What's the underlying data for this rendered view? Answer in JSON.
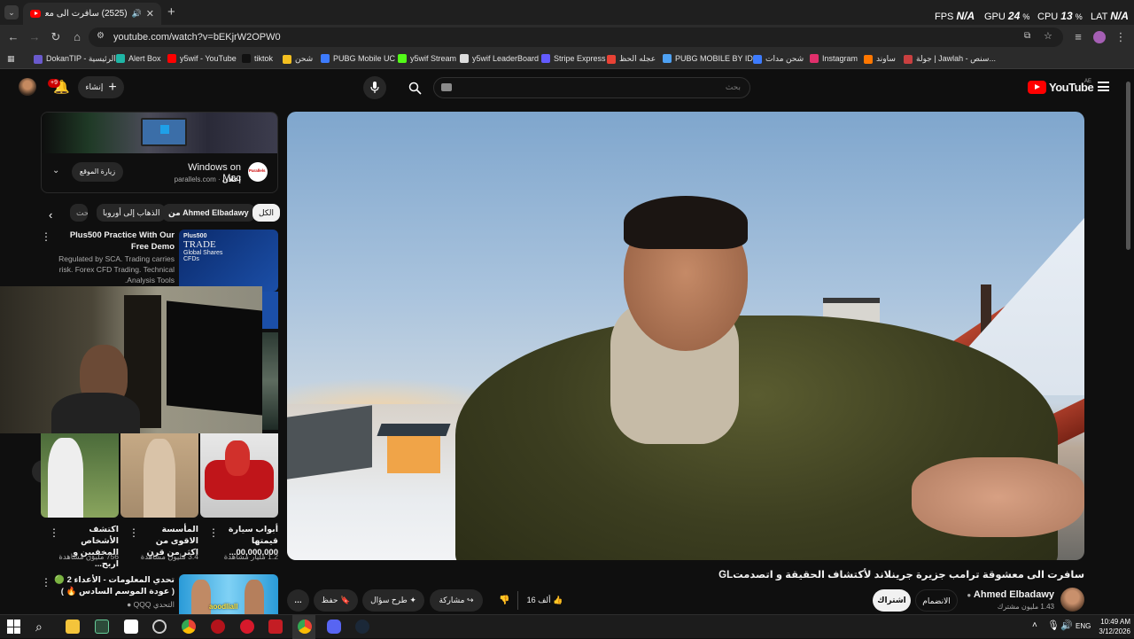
{
  "browser": {
    "tab_title": "(2525) سافرت الى معشوقة",
    "new_tab": "+",
    "url": "youtube.com/watch?v=bEKjrW2OPW0",
    "hud": {
      "fps_label": "FPS",
      "fps_value": "N/A",
      "gpu_label": "GPU",
      "gpu_value": "24",
      "gpu_unit": "%",
      "cpu_label": "CPU",
      "cpu_value": "13",
      "cpu_unit": "%",
      "lat_label": "LAT",
      "lat_value": "N/A"
    },
    "bookmarks": [
      {
        "label": "DokanTIP - الرئيسية",
        "color": "#6a5acd"
      },
      {
        "label": "Alert Box",
        "color": "#1fb6a6"
      },
      {
        "label": "y5wif - YouTube",
        "color": "#ff0000"
      },
      {
        "label": "tiktok",
        "color": "#111111"
      },
      {
        "label": "شحن",
        "color": "#f4c020"
      },
      {
        "label": "PUBG Mobile UC",
        "color": "#3d7bfd"
      },
      {
        "label": "y5wif Stream",
        "color": "#53fc18"
      },
      {
        "label": "y5wif LeaderBoard",
        "color": "#dddddd"
      },
      {
        "label": "Stripe Express",
        "color": "#635bff"
      },
      {
        "label": "عجله الحظ",
        "color": "#e94235"
      },
      {
        "label": "PUBG MOBILE BY ID...",
        "color": "#4ea1f3"
      },
      {
        "label": "شحن مدات",
        "color": "#3d7bfd"
      },
      {
        "label": "Instagram",
        "color": "#e1306c"
      },
      {
        "label": "ساوند",
        "color": "#ff7700"
      },
      {
        "label": "جولة | Jawlah - سنص...",
        "color": "#c94040"
      }
    ]
  },
  "youtube": {
    "logo_text": "YouTube",
    "region": "AE",
    "search_placeholder": "بحث",
    "create_label": "إنشاء",
    "notifications_badge": "+9",
    "ad": {
      "title": "Windows on Mac",
      "sponsor": "إعلان",
      "domain": "parallels.com",
      "visit_label": "زيارة الموقع",
      "logo_text": "Parallels"
    },
    "chips": [
      "الكل",
      "من Ahmed Elbadawy",
      "الذهاب إلى أوروبا",
      "محت"
    ],
    "promo": {
      "title": "Plus500 Practice With Our Free Demo",
      "desc": "Regulated by SCA. Trading carries risk. Forex CFD Trading. Technical Analysis Tools.",
      "thumb_brand": "Plus500",
      "thumb_line1": "TRADE",
      "thumb_line2": "Global Shares",
      "thumb_line3": "CFDs"
    },
    "shorts": [
      {
        "title": "أبواب سيارة قيمتها 00,000,000...",
        "views": "1.2 مليار مشاهدة"
      },
      {
        "title": "المأسسة الاقوى من اكثر من قرن",
        "views": "3.4 مليون مشاهدة"
      },
      {
        "title": "اكتشف الأشخاص المخفيين و اربح...",
        "views": "756 مليون مشاهدة"
      }
    ],
    "next_video": {
      "title": "تحدي المعلومات - الأعداء 2 🟢 ( عودة الموسم السادس 🔥 )",
      "channel": "التحدي QQQ",
      "thumb_text": "aoodliall"
    },
    "video": {
      "title": "سافرت الى معشوقة ترامب جزيرة جرينلاند لأكتشاف الحقيقة و اتصدمتGL",
      "channel": "Ahmed Elbadawy",
      "subscribers": "1.43 مليون مشترك",
      "join_label": "الانضمام",
      "subscribe_label": "اشتراك",
      "likes": "16 ألف",
      "share_label": "مشاركة",
      "ask_label": "طرح سؤال",
      "save_label": "حفظ"
    }
  },
  "taskbar": {
    "lang": "ENG",
    "time": "10:49 AM",
    "date": "3/12/2026"
  }
}
